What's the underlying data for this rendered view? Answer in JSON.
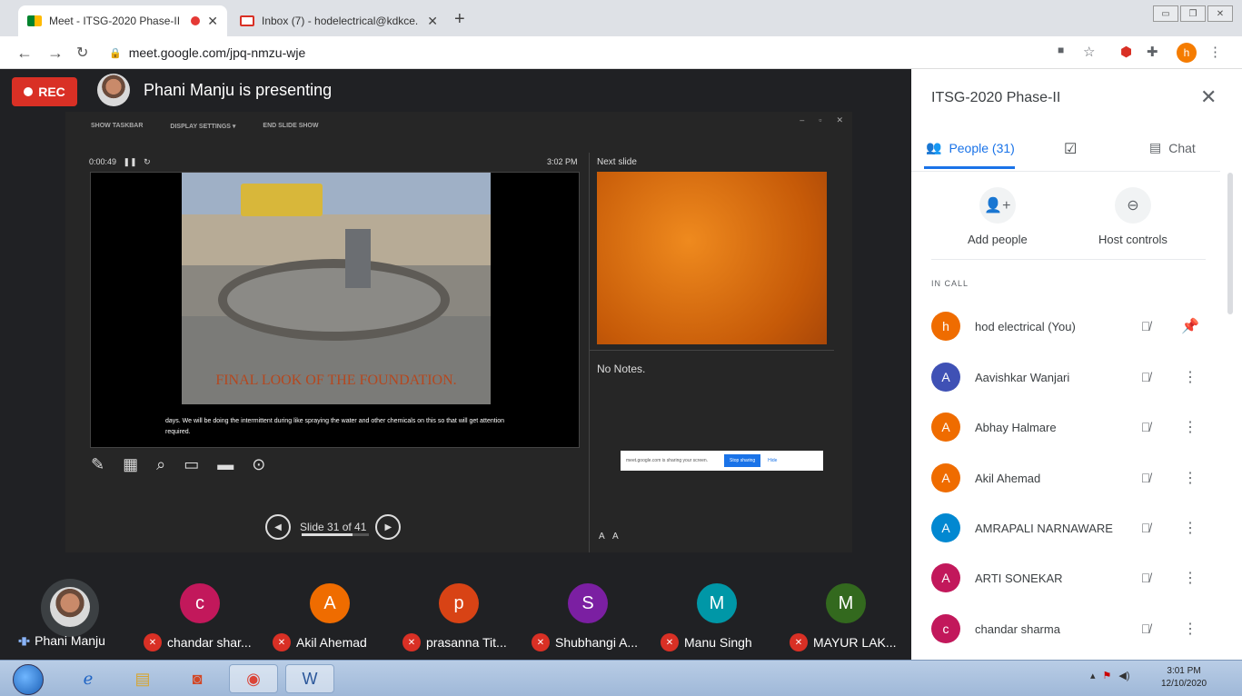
{
  "browser": {
    "tabs": [
      {
        "title": "Meet - ITSG-2020 Phase-II",
        "active": true
      },
      {
        "title": "Inbox (7) - hodelectrical@kdkce.",
        "active": false
      }
    ],
    "url": "meet.google.com/jpq-nmzu-wje",
    "profile_initial": "h"
  },
  "meet": {
    "rec_label": "REC",
    "presenting_text": "Phani Manju is presenting",
    "slideshow": {
      "toolbar": [
        "SHOW TASKBAR",
        "DISPLAY SETTINGS ▾",
        "END SLIDE SHOW"
      ],
      "timer": "0:00:49",
      "clock": "3:02 PM",
      "next_slide_label": "Next slide",
      "slide_title": "FINAL LOOK OF THE FOUNDATION.",
      "caption": "days. We will be doing the intermittent during like spraying the water and other chemicals on this so that will get attention required.",
      "notes": "No Notes.",
      "slide_counter": "Slide 31 of 41",
      "progress": 0.756,
      "share_bar": {
        "text": "meet.google.com is sharing your screen.",
        "stop": "Stop sharing",
        "hide": "Hide"
      }
    },
    "strip": [
      {
        "name": "Phani Manju",
        "initial": "",
        "color": "#3c4043",
        "muted": false
      },
      {
        "name": "chandar shar...",
        "initial": "c",
        "color": "#c2185b",
        "muted": true
      },
      {
        "name": "Akil Ahemad",
        "initial": "A",
        "color": "#ef6c00",
        "muted": true
      },
      {
        "name": "prasanna Tit...",
        "initial": "p",
        "color": "#d84315",
        "muted": true
      },
      {
        "name": "Shubhangi A...",
        "initial": "S",
        "color": "#7b1fa2",
        "muted": true
      },
      {
        "name": "Manu Singh",
        "initial": "M",
        "color": "#0097a7",
        "muted": true
      },
      {
        "name": "MAYUR LAK...",
        "initial": "M",
        "color": "#33691e",
        "muted": true
      }
    ]
  },
  "panel": {
    "title": "ITSG-2020 Phase-II",
    "tab_people": "People (31)",
    "tab_chat": "Chat",
    "add_people": "Add people",
    "host_controls": "Host controls",
    "in_call": "IN CALL",
    "participants": [
      {
        "name": "hod electrical (You)",
        "initial": "h",
        "color": "#ef6c00"
      },
      {
        "name": "Aavishkar Wanjari",
        "initial": "A",
        "color": "#3f51b5"
      },
      {
        "name": "Abhay Halmare",
        "initial": "A",
        "color": "#ef6c00"
      },
      {
        "name": "Akil Ahemad",
        "initial": "A",
        "color": "#ef6c00"
      },
      {
        "name": "AMRAPALI NARNAWARE",
        "initial": "A",
        "color": "#0288d1"
      },
      {
        "name": "ARTI SONEKAR",
        "initial": "A",
        "color": "#c2185b"
      },
      {
        "name": "chandar sharma",
        "initial": "c",
        "color": "#c2185b"
      }
    ]
  },
  "taskbar": {
    "time": "3:01 PM",
    "date": "12/10/2020"
  }
}
